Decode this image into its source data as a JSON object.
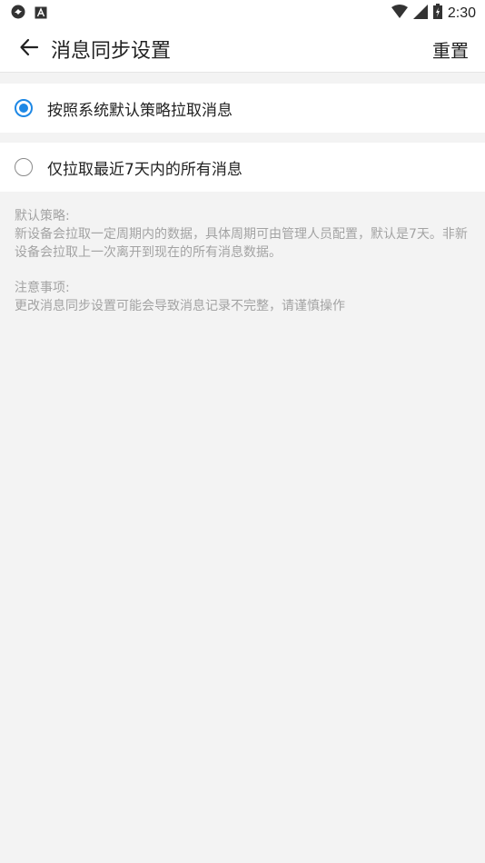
{
  "status_bar": {
    "time": "2:30",
    "icons": [
      "sync-icon",
      "notification-a-icon",
      "wifi-icon",
      "signal-icon",
      "battery-icon"
    ]
  },
  "header": {
    "title": "消息同步设置",
    "back_icon": "arrow-left-icon",
    "reset_label": "重置"
  },
  "options": [
    {
      "label": "按照系统默认策略拉取消息",
      "selected": true
    },
    {
      "label": "仅拉取最近7天内的所有消息",
      "selected": false
    }
  ],
  "notes": {
    "default_title": "默认策略:",
    "default_text": "新设备会拉取一定周期内的数据，具体周期可由管理人员配置，默认是7天。非新设备会拉取上一次离开到现在的所有消息数据。",
    "caution_title": "注意事项:",
    "caution_text": "更改消息同步设置可能会导致消息记录不完整，请谨慎操作"
  },
  "colors": {
    "accent": "#1e88e5",
    "background": "#f3f3f3",
    "note_text": "#a3a3a3"
  }
}
